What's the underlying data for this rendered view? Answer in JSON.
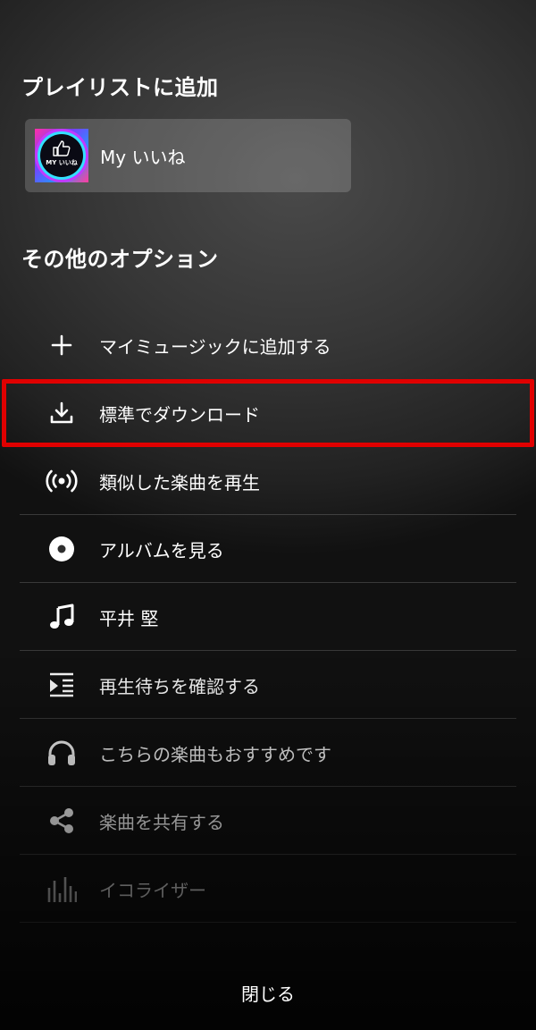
{
  "sections": {
    "add_to_playlist": "プレイリストに追加",
    "other_options": "その他のオプション"
  },
  "playlist": {
    "name": "My いいね",
    "thumbnail_text": "MY いいね",
    "thumbnail_icon": "thumbs-up-icon"
  },
  "menu": {
    "items": [
      {
        "label": "マイミュージックに追加する",
        "icon": "plus-icon"
      },
      {
        "label": "標準でダウンロード",
        "icon": "download-icon"
      },
      {
        "label": "類似した楽曲を再生",
        "icon": "broadcast-icon"
      },
      {
        "label": "アルバムを見る",
        "icon": "album-disc-icon"
      },
      {
        "label": "平井 堅",
        "icon": "music-note-icon"
      },
      {
        "label": "再生待ちを確認する",
        "icon": "queue-icon"
      },
      {
        "label": "こちらの楽曲もおすすめです",
        "icon": "headphones-icon"
      },
      {
        "label": "楽曲を共有する",
        "icon": "share-icon"
      },
      {
        "label": "イコライザー",
        "icon": "equalizer-icon"
      }
    ]
  },
  "footer": {
    "close_label": "閉じる"
  },
  "colors": {
    "highlight": "#e00000",
    "text": "#ffffff"
  }
}
